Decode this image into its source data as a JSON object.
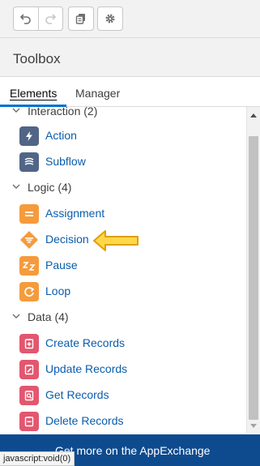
{
  "toolbar": {
    "undo_icon": "undo-icon",
    "redo_icon": "redo-icon",
    "copy_icon": "copy-icon",
    "settings_icon": "gear-icon"
  },
  "panel": {
    "title": "Toolbox"
  },
  "tabs": [
    {
      "label": "Elements",
      "active": true
    },
    {
      "label": "Manager",
      "active": false
    }
  ],
  "sections": [
    {
      "label": "Interaction (2)",
      "items": [
        {
          "label": "Action",
          "icon": "lightning-icon",
          "color": "#516586"
        },
        {
          "label": "Subflow",
          "icon": "subflow-icon",
          "color": "#516586"
        }
      ]
    },
    {
      "label": "Logic (4)",
      "items": [
        {
          "label": "Assignment",
          "icon": "assignment-icon",
          "color": "#f59b3d"
        },
        {
          "label": "Decision",
          "icon": "decision-icon",
          "color": "#f59b3d"
        },
        {
          "label": "Pause",
          "icon": "pause-zz-icon",
          "color": "#f59b3d"
        },
        {
          "label": "Loop",
          "icon": "loop-icon",
          "color": "#f59b3d"
        }
      ]
    },
    {
      "label": "Data (4)",
      "items": [
        {
          "label": "Create Records",
          "icon": "create-records-icon",
          "color": "#e3566f"
        },
        {
          "label": "Update Records",
          "icon": "update-records-icon",
          "color": "#e3566f"
        },
        {
          "label": "Get Records",
          "icon": "get-records-icon",
          "color": "#e3566f"
        },
        {
          "label": "Delete Records",
          "icon": "delete-records-icon",
          "color": "#e3566f"
        }
      ]
    }
  ],
  "footer": {
    "label": "Get more on the AppExchange"
  },
  "status_bar": {
    "text": "javascript:void(0)"
  },
  "annotation": {
    "icon": "pointer-arrow-icon",
    "color": "#f1b400"
  }
}
